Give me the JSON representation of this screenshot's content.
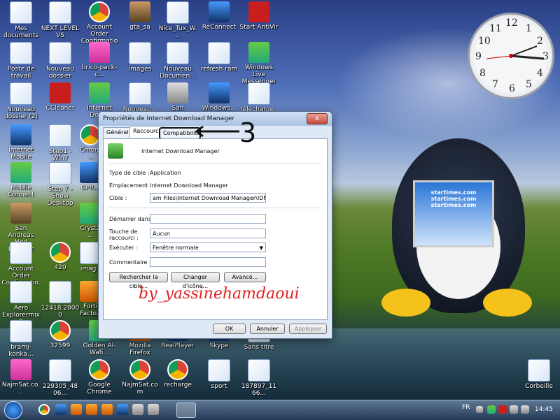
{
  "desktop_icons": [
    {
      "label": "Mes documents"
    },
    {
      "label": "NEXT LEVEL VS"
    },
    {
      "label": "Account Order Confirmation"
    },
    {
      "label": "gta_sa"
    },
    {
      "label": "Nice_Tux_W..."
    },
    {
      "label": "ReConnect"
    },
    {
      "label": "Start AntiVir"
    },
    {
      "label": "Poste de travail"
    },
    {
      "label": "Nouveau dossier"
    },
    {
      "label": "brico-pack-c..."
    },
    {
      "label": "images"
    },
    {
      "label": "Nouveau Documen..."
    },
    {
      "label": "refresh ram"
    },
    {
      "label": "Windows Live Messenger"
    },
    {
      "label": "Nouveau dossier (2)"
    },
    {
      "label": "CCleaner"
    },
    {
      "label": "Internet Dow..."
    },
    {
      "label": "Nouveau..."
    },
    {
      "label": "San Andreas..."
    },
    {
      "label": "Windows..."
    },
    {
      "label": "télécharge..."
    },
    {
      "label": "Internet Mobile"
    },
    {
      "label": "Step1 - Win7 Theme"
    },
    {
      "label": "Chrom..."
    },
    {
      "label": "Mobile Connect"
    },
    {
      "label": "Step 7 - Show Desktop"
    },
    {
      "label": "GPR..."
    },
    {
      "label": "San Andreas Mod Installer"
    },
    {
      "label": "Crysta..."
    },
    {
      "label": "Account Order Confirmatio..."
    },
    {
      "label": "420"
    },
    {
      "label": "imag..."
    },
    {
      "label": "Aero Explorermix2"
    },
    {
      "label": "12418.28000"
    },
    {
      "label": "Forti Facto..."
    },
    {
      "label": "bramj-konka..."
    },
    {
      "label": "32599"
    },
    {
      "label": "Golden Al-Wafi..."
    },
    {
      "label": "Mozilla Firefox"
    },
    {
      "label": "RealPlayer"
    },
    {
      "label": "Skype"
    },
    {
      "label": "Sans titre"
    },
    {
      "label": "NajmSat.co..."
    },
    {
      "label": "229305_4806..."
    },
    {
      "label": "Google Chrome"
    },
    {
      "label": "NajmSat.com"
    },
    {
      "label": "recharge"
    },
    {
      "label": "sport"
    },
    {
      "label": "187897_1166..."
    },
    {
      "label": "Corbeille"
    }
  ],
  "dialog": {
    "title": "Propriétés de Internet Download Manager",
    "close": "x",
    "tabs": [
      "Général",
      "Raccourci",
      "Compatibilité"
    ],
    "app_name": "Internet Download Manager",
    "type_label": "Type de cible :",
    "type_value": "Application",
    "location_label": "Emplacement :",
    "location_value": "Internet Download Manager",
    "target_label": "Cible :",
    "target_value": "am Files\\Internet Download Manager\\IDMan.exe\"",
    "start_in_label": "Démarrer dans :",
    "start_in_value": "",
    "shortcut_label": "Touche de raccourci :",
    "shortcut_value": "Aucun",
    "run_label": "Exécuter :",
    "run_value": "Fenêtre normale",
    "comment_label": "Commentaire :",
    "comment_value": "",
    "btn_find": "Rechercher la cible...",
    "btn_icon": "Changer d'icône...",
    "btn_advanced": "Avancé...",
    "btn_ok": "OK",
    "btn_cancel": "Annuler",
    "btn_apply": "Appliquer"
  },
  "annotation": {
    "step": "3",
    "signature": "by_yassinehamdaoui"
  },
  "clock": {
    "numerals": [
      "12",
      "1",
      "2",
      "3",
      "4",
      "5",
      "6",
      "7",
      "8",
      "9",
      "10",
      "11"
    ]
  },
  "banner": {
    "lines": [
      "startimes.com",
      "startimes.com",
      "startimes.com"
    ]
  },
  "tray": {
    "lang": "FR",
    "time": "14:45"
  }
}
